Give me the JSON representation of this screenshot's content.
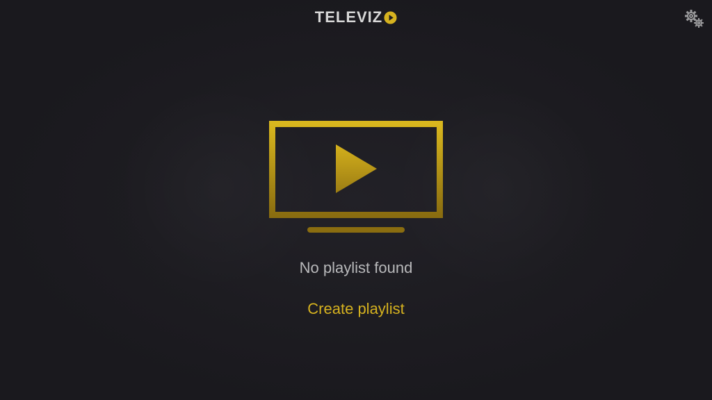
{
  "app": {
    "logo_text": "TELEVIZ",
    "logo_icon": "play-o-icon"
  },
  "header": {
    "settings_icon": "gears-icon"
  },
  "empty_state": {
    "illustration_icon": "tv-play-icon",
    "message": "No playlist found",
    "action_label": "Create playlist"
  },
  "colors": {
    "background": "#1d1c21",
    "accent": "#d6b21f",
    "accent_dark": "#8a6d10",
    "text_muted": "#b9b9bb",
    "logo_text": "#d8d8d8"
  }
}
